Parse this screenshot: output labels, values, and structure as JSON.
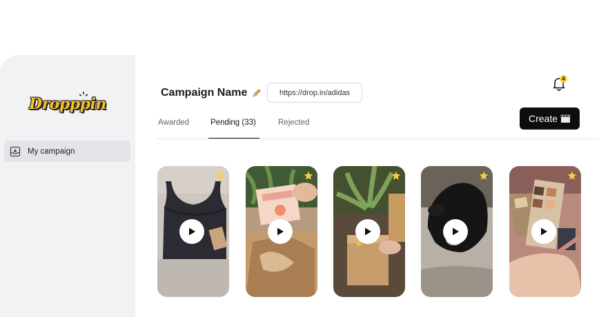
{
  "brand": {
    "logo_text": "Dropppin"
  },
  "sidebar": {
    "items": [
      {
        "label": "My campaign",
        "icon": "inbox-icon"
      }
    ]
  },
  "header": {
    "title": "Campaign Name",
    "title_icon": "pencil-icon",
    "url": "https://drop.in/adidas",
    "notification_count": "4",
    "create_label": "Create",
    "create_icon": "clapperboard-icon"
  },
  "tabs": [
    {
      "label": "Awarded",
      "active": false
    },
    {
      "label": "Pending (33)",
      "active": true
    },
    {
      "label": "Rejected",
      "active": false
    }
  ],
  "colors": {
    "accent": "#f8d23c",
    "button_bg": "#0d0d0d",
    "sidebar_bg": "#f1f2f4",
    "active_nav_bg": "#e2e4e8"
  },
  "videos": [
    {
      "thumb": "sports-bra",
      "starred": true
    },
    {
      "thumb": "unboxing-peaches",
      "starred": true
    },
    {
      "thumb": "package-plant",
      "starred": true
    },
    {
      "thumb": "black-dog",
      "starred": true
    },
    {
      "thumb": "makeup-palette",
      "starred": true
    }
  ]
}
